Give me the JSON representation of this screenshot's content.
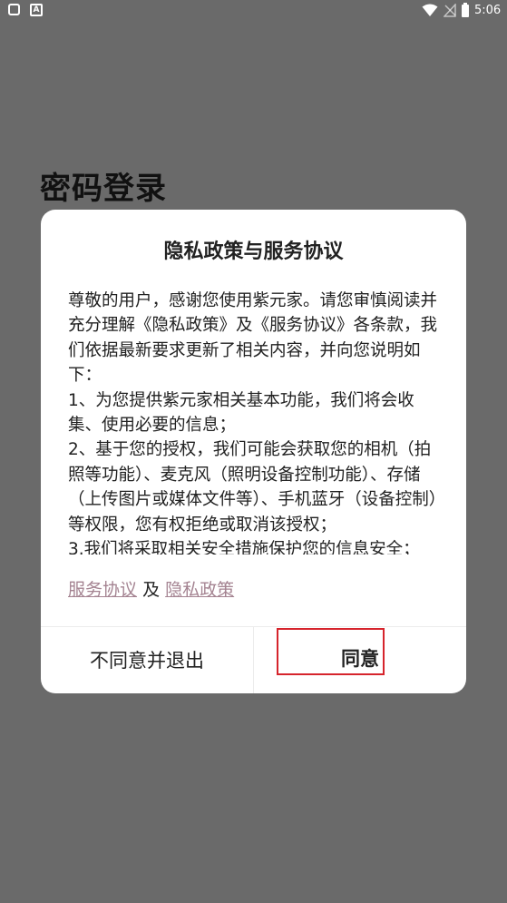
{
  "status_bar": {
    "time": "5:06",
    "app_badge": "A",
    "icons": [
      "square-notification-icon",
      "a-badge-icon",
      "wifi-icon",
      "no-signal-icon",
      "battery-icon"
    ]
  },
  "page": {
    "title": "密码登录"
  },
  "dialog": {
    "title": "隐私政策与服务协议",
    "paragraphs": [
      "尊敬的用户，感谢您使用紫元家。请您审慎阅读并充分理解《隐私政策》及《服务协议》各条款，我们依据最新要求更新了相关内容，并向您说明如下：",
      "1、为您提供紫元家相关基本功能，我们将会收集、使用必要的信息；",
      "2、基于您的授权，我们可能会获取您的相机（拍照等功能）、麦克风（照明设备控制功能）、存储（上传图片或媒体文件等）、手机蓝牙（设备控制）等权限，您有权拒绝或取消该授权；",
      "3.我们将采取相关安全措施保护您的信息安全；"
    ],
    "link_service": "服务协议",
    "link_joiner": "及",
    "link_privacy": "隐私政策",
    "disagree_label": "不同意并退出",
    "agree_label": "同意"
  },
  "colors": {
    "overlay_background": "#6a6a6a",
    "dialog_background": "#ffffff",
    "link": "#a48391",
    "highlight_box": "#d6242c",
    "text": "#222222"
  }
}
